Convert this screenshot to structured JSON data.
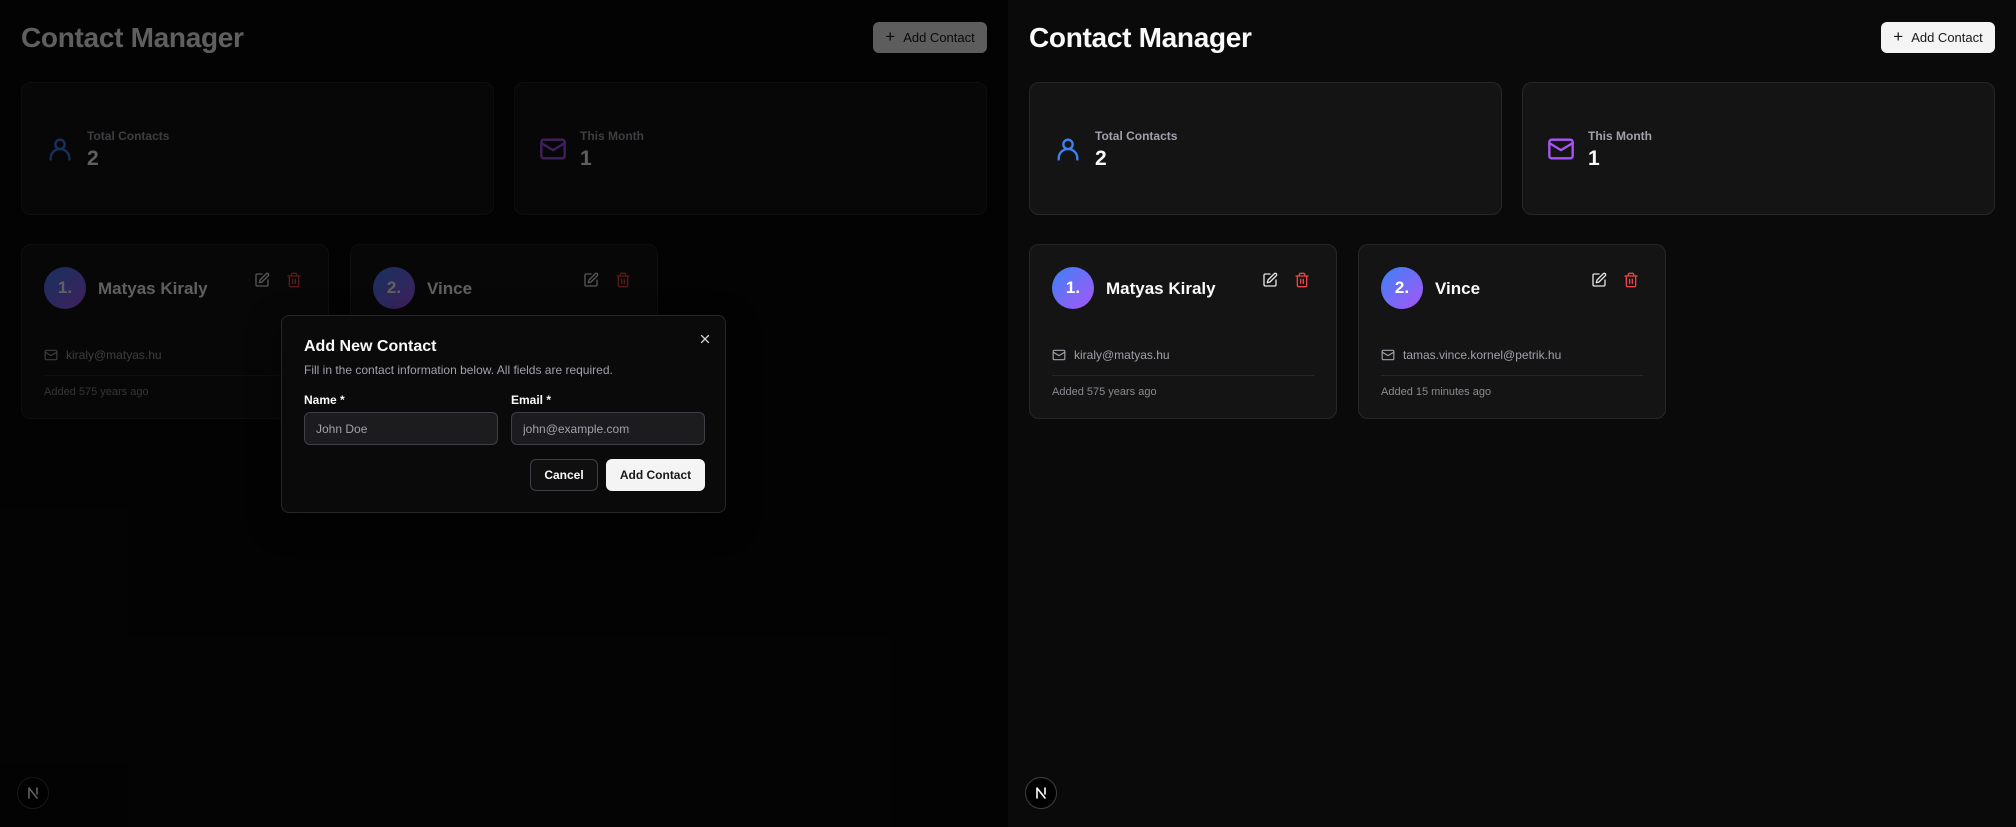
{
  "app": {
    "title": "Contact Manager",
    "add_button_label": "Add Contact",
    "accent_blue": "#3b82f6",
    "accent_purple": "#a855f7",
    "danger": "#ef4444"
  },
  "stats": [
    {
      "label": "Total Contacts",
      "value": "2",
      "icon": "user-icon"
    },
    {
      "label": "This Month",
      "value": "1",
      "icon": "mail-icon"
    }
  ],
  "contacts": [
    {
      "index": "1.",
      "name": "Matyas Kiraly",
      "email": "kiraly@matyas.hu",
      "added": "Added 575 years ago"
    },
    {
      "index": "2.",
      "name": "Vince",
      "email": "tamas.vince.kornel@petrik.hu",
      "added": "Added 15 minutes ago"
    }
  ],
  "dialog": {
    "title": "Add New Contact",
    "description": "Fill in the contact information below. All fields are required.",
    "name_label": "Name *",
    "name_placeholder": "John Doe",
    "email_label": "Email *",
    "email_placeholder": "john@example.com",
    "cancel_label": "Cancel",
    "submit_label": "Add Contact"
  },
  "logo_letter": "N"
}
